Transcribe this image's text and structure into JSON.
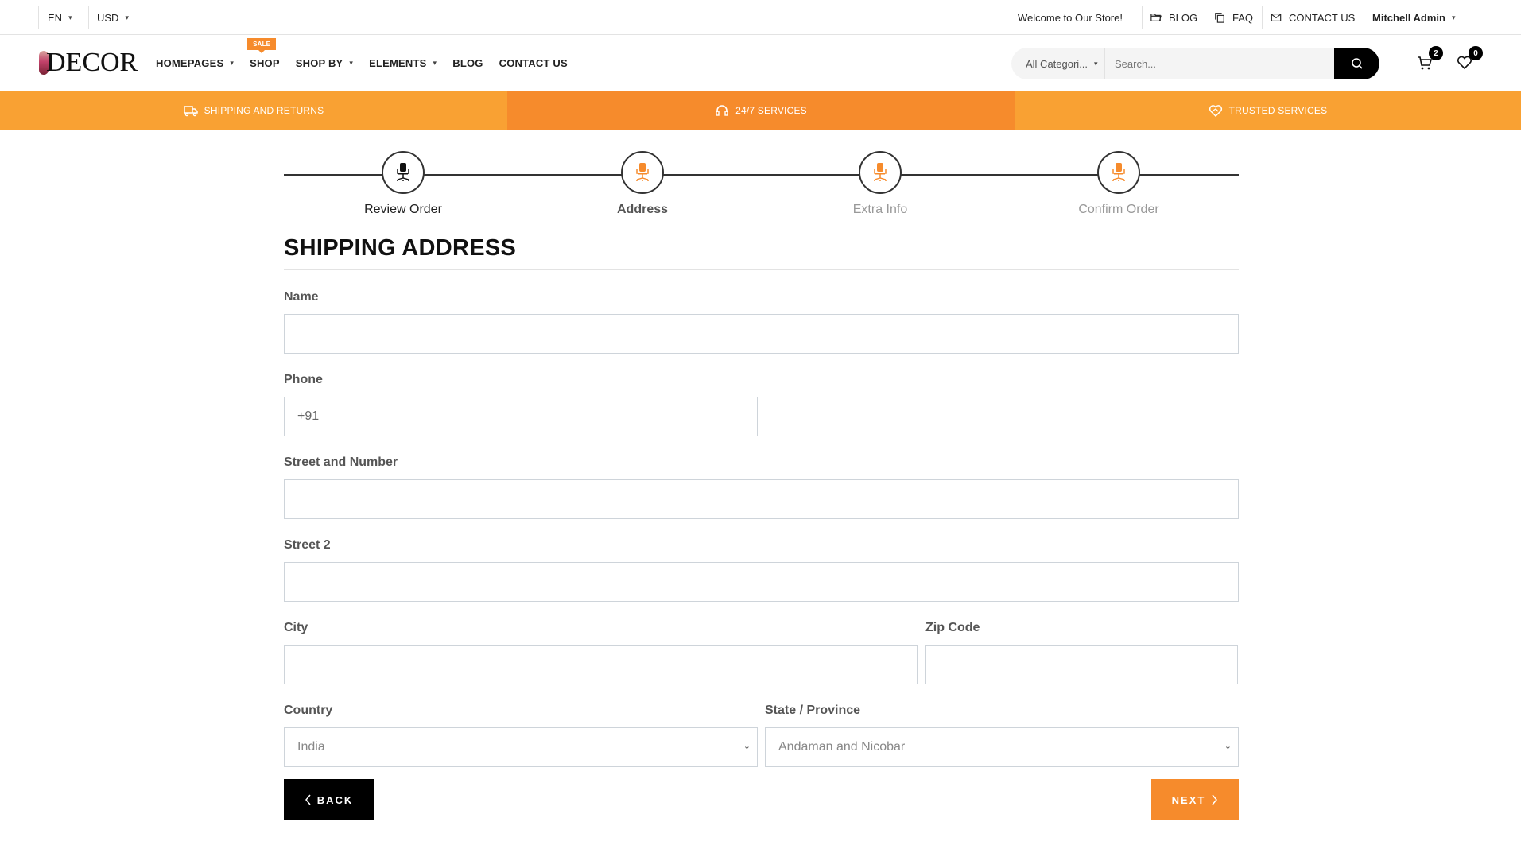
{
  "topbar": {
    "language": "EN",
    "currency": "USD",
    "welcome": "Welcome to Our Store!",
    "links": [
      {
        "label": "BLOG",
        "icon": "folder-icon"
      },
      {
        "label": "FAQ",
        "icon": "copy-icon"
      },
      {
        "label": "CONTACT US",
        "icon": "mail-icon"
      }
    ],
    "user": "Mitchell Admin"
  },
  "header": {
    "logo": "DECOR",
    "nav": [
      {
        "label": "HOMEPAGES",
        "dropdown": true
      },
      {
        "label": "SHOP",
        "dropdown": false,
        "badge": "SALE"
      },
      {
        "label": "SHOP BY",
        "dropdown": true
      },
      {
        "label": "ELEMENTS",
        "dropdown": true
      },
      {
        "label": "BLOG",
        "dropdown": false
      },
      {
        "label": "CONTACT US",
        "dropdown": false
      }
    ],
    "search": {
      "category": "All Categori...",
      "placeholder": "Search..."
    },
    "cart_count": "2",
    "wishlist_count": "0"
  },
  "band": {
    "items": [
      {
        "label": "SHIPPING AND RETURNS",
        "icon": "truck-icon",
        "color": "#f9a133"
      },
      {
        "label": "24/7 SERVICES",
        "icon": "headphones-icon",
        "color": "#f68b2c"
      },
      {
        "label": "TRUSTED SERVICES",
        "icon": "heart-handshake-icon",
        "color": "#f9a133"
      }
    ]
  },
  "steps": [
    {
      "label": "Review Order",
      "state": "done"
    },
    {
      "label": "Address",
      "state": "current"
    },
    {
      "label": "Extra Info",
      "state": "pending"
    },
    {
      "label": "Confirm Order",
      "state": "pending"
    }
  ],
  "form": {
    "title": "SHIPPING ADDRESS",
    "name": {
      "label": "Name",
      "value": ""
    },
    "phone": {
      "label": "Phone",
      "value": "+91"
    },
    "street": {
      "label": "Street and Number",
      "value": ""
    },
    "street2": {
      "label": "Street 2",
      "value": ""
    },
    "city": {
      "label": "City",
      "value": ""
    },
    "zip": {
      "label": "Zip Code",
      "value": ""
    },
    "country": {
      "label": "Country",
      "value": "India"
    },
    "state": {
      "label": "State / Province",
      "value": "Andaman and Nicobar"
    },
    "back_label": "BACK",
    "next_label": "NEXT"
  },
  "colors": {
    "accent": "#f68b2c",
    "accent_light": "#f9a133",
    "dark": "#000000"
  }
}
